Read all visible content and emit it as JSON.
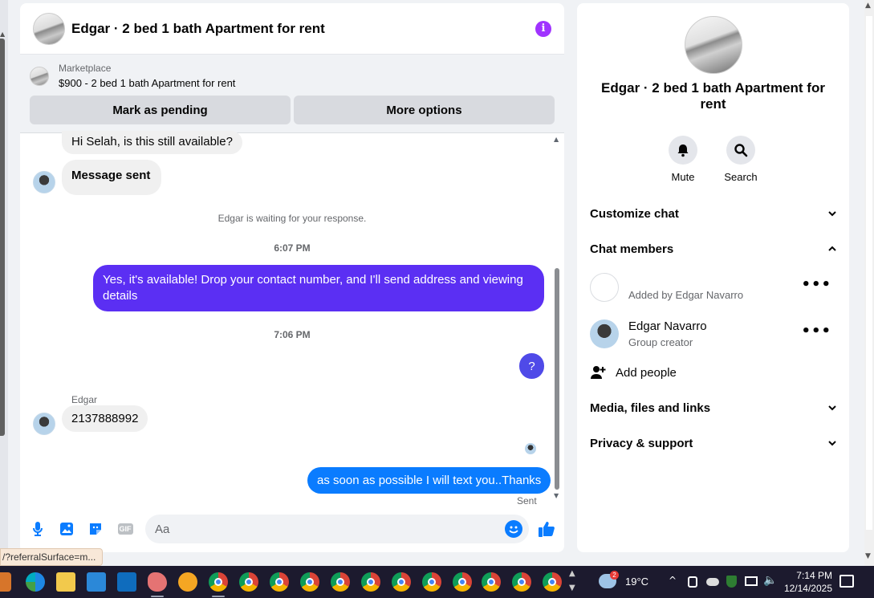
{
  "chat": {
    "title": "Edgar · 2 bed 1 bath Apartment for rent",
    "marketplace_label": "Marketplace",
    "listing": "$900 - 2 bed 1 bath Apartment for rent",
    "mark_pending_label": "Mark as pending",
    "more_options_label": "More options"
  },
  "messages": {
    "msg1": "Hi Selah, is this still available?",
    "msg2": "Message sent",
    "system": "Edgar is waiting for your response.",
    "time1": "6:07 PM",
    "out1": "Yes, it's available! Drop your contact number, and I'll send address and viewing details",
    "time2": "7:06 PM",
    "out2": "?",
    "sender": "Edgar",
    "in3": "2137888992",
    "out3": "as soon as possible I will text you..Thanks",
    "status": "Sent"
  },
  "composer": {
    "placeholder": "Aa",
    "gif_label": "GIF"
  },
  "side": {
    "title": "Edgar · 2 bed 1 bath Apartment for rent",
    "mute_label": "Mute",
    "search_label": "Search",
    "customize": "Customize chat",
    "members": "Chat members",
    "member1_sub": "Added by Edgar Navarro",
    "member2_name": "Edgar Navarro",
    "member2_sub": "Group creator",
    "add_people": "Add people",
    "media": "Media, files and links",
    "privacy": "Privacy & support"
  },
  "statusbar": {
    "url": "/?referralSurface=m..."
  },
  "taskbar": {
    "weather_badge": "2",
    "temperature": "19°C",
    "time": "7:14 PM",
    "date": "12/14/2025"
  },
  "colors": {
    "accent_blue": "#0a7cff",
    "purple_bubble": "#5b2ff3",
    "info_purple": "#a033ff"
  }
}
